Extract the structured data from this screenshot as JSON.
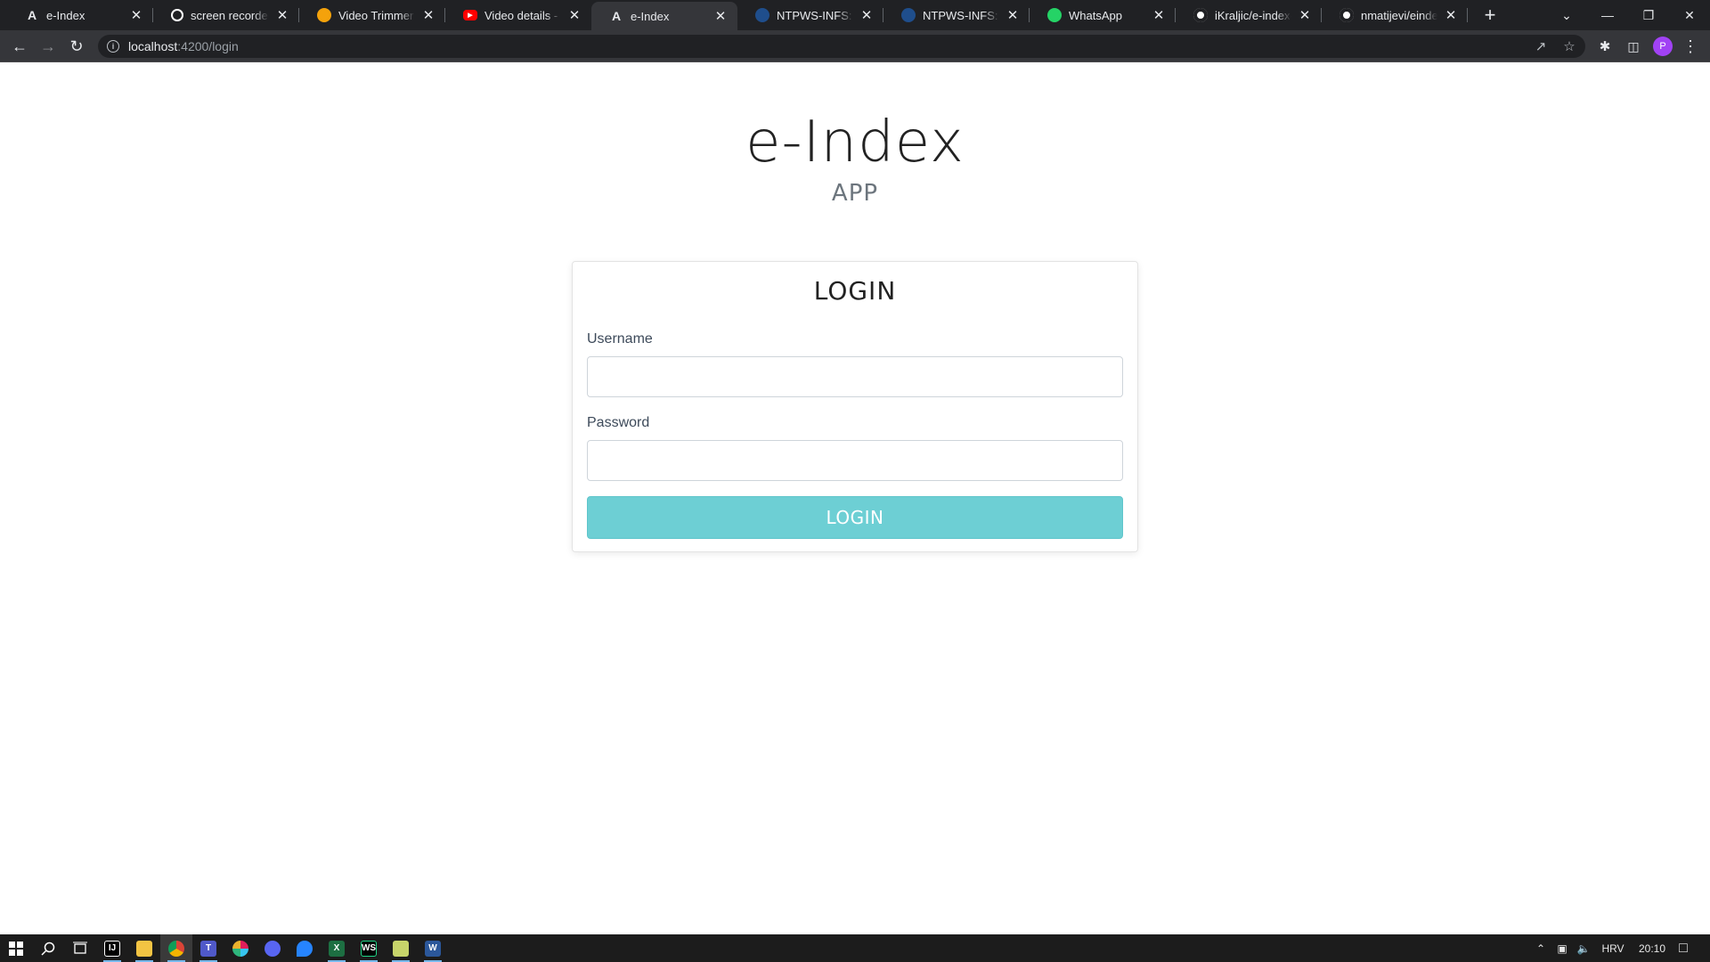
{
  "browser": {
    "tabs": [
      {
        "title": "e-Index",
        "icon": "angular-icon",
        "color": "#202124"
      },
      {
        "title": "screen recorder - Go",
        "icon": "google-icon",
        "color": "#ffffff"
      },
      {
        "title": "Video Trimmer - Cu",
        "icon": "video-trimmer-icon",
        "color": "#f4a20b"
      },
      {
        "title": "Video details - You",
        "icon": "youtube-icon",
        "color": "#ff0000"
      },
      {
        "title": "e-Index",
        "icon": "angular-icon",
        "color": "#35363a",
        "active": true
      },
      {
        "title": "NTPWS-INFS: Rasp",
        "icon": "moodle-icon",
        "color": "#1f4e8c"
      },
      {
        "title": "NTPWS-INFS: Pred",
        "icon": "moodle-icon",
        "color": "#1f4e8c"
      },
      {
        "title": "WhatsApp",
        "icon": "whatsapp-icon",
        "color": "#25d366"
      },
      {
        "title": "iKraljic/e-index-fro",
        "icon": "github-icon",
        "color": "#ffffff"
      },
      {
        "title": "nmatijevi/eindex_b",
        "icon": "github-icon",
        "color": "#ffffff"
      }
    ],
    "new_tab_label": "+",
    "url_host": "localhost",
    "url_path": ":4200/login",
    "profile_initial": "P"
  },
  "page": {
    "app_title": "e-Index",
    "app_subtitle": "APP",
    "login_card": {
      "title": "LOGIN",
      "username_label": "Username",
      "username_value": "",
      "password_label": "Password",
      "password_value": "",
      "submit_label": "LOGIN",
      "accent_color": "#6dcfd4"
    }
  },
  "taskbar": {
    "language": "HRV",
    "time": "20:10"
  }
}
